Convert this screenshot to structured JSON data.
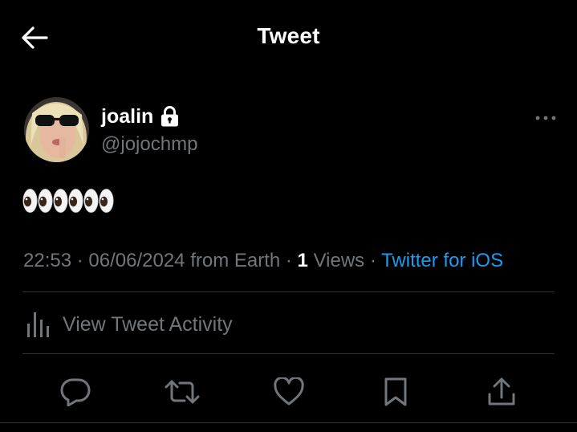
{
  "header": {
    "title": "Tweet",
    "back_icon": "back-arrow-icon"
  },
  "tweet": {
    "author": {
      "display_name": "joalin",
      "handle": "@jojochmp",
      "protected_icon": "lock-icon",
      "avatar_icon": "avatar"
    },
    "text": "👀👀👀",
    "eye_count": 6,
    "meta": {
      "time": "22:53",
      "separator": " · ",
      "date": "06/06/2024",
      "location": "from Earth",
      "views_count": "1",
      "views_label": "Views",
      "source": "Twitter for iOS"
    },
    "more_icon": "more-options-icon"
  },
  "activity": {
    "label": "View Tweet Activity",
    "icon": "analytics-icon"
  },
  "actions": [
    {
      "name": "reply",
      "icon": "reply-icon"
    },
    {
      "name": "retweet",
      "icon": "retweet-icon"
    },
    {
      "name": "like",
      "icon": "like-icon"
    },
    {
      "name": "bookmark",
      "icon": "bookmark-icon"
    },
    {
      "name": "share",
      "icon": "share-icon"
    }
  ],
  "colors": {
    "background": "#000000",
    "primary_text": "#ffffff",
    "secondary_text": "#71767b",
    "link": "#1d9bf0",
    "divider": "#2f3336"
  }
}
